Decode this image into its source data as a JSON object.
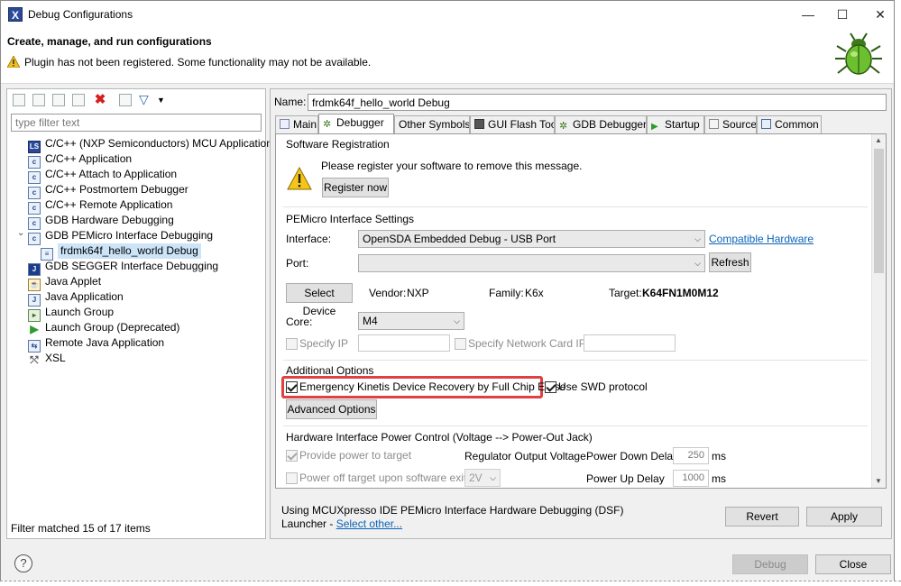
{
  "window": {
    "title": "Debug Configurations",
    "minimize": "—",
    "maximize": "☐",
    "close": "✕"
  },
  "header": {
    "title": "Create, manage, and run configurations",
    "message": "Plugin has not been registered. Some functionality may not be available."
  },
  "left": {
    "filter_placeholder": "type filter text",
    "items": [
      {
        "label": "C/C++ (NXP Semiconductors) MCU Application",
        "icon": "ls-icon"
      },
      {
        "label": "C/C++ Application",
        "icon": "c-icon"
      },
      {
        "label": "C/C++ Attach to Application",
        "icon": "c-icon"
      },
      {
        "label": "C/C++ Postmortem Debugger",
        "icon": "c-icon"
      },
      {
        "label": "C/C++ Remote Application",
        "icon": "c-icon"
      },
      {
        "label": "GDB Hardware Debugging",
        "icon": "c-icon"
      },
      {
        "label": "GDB PEMicro Interface Debugging",
        "icon": "c-icon"
      },
      {
        "label": "frdmk64f_hello_world Debug",
        "icon": "config-icon"
      },
      {
        "label": "GDB SEGGER Interface Debugging",
        "icon": "jlink-icon"
      },
      {
        "label": "Java Applet",
        "icon": "applet-icon"
      },
      {
        "label": "Java Application",
        "icon": "java-icon"
      },
      {
        "label": "Launch Group",
        "icon": "launch-group-icon"
      },
      {
        "label": "Launch Group (Deprecated)",
        "icon": "play-icon"
      },
      {
        "label": "Remote Java Application",
        "icon": "remote-java-icon"
      },
      {
        "label": "XSL",
        "icon": "xsl-icon"
      }
    ],
    "status": "Filter matched 15 of 17 items"
  },
  "right": {
    "name_label": "Name:",
    "name_value": "frdmk64f_hello_world Debug",
    "tabs": [
      "Main",
      "Debugger",
      "Other Symbols",
      "GUI Flash Tool",
      "GDB Debugger",
      "Startup",
      "Source",
      "Common"
    ],
    "software_registration": {
      "title": "Software Registration",
      "message": "Please register your software to remove this message.",
      "register_button": "Register now"
    },
    "pemicro": {
      "title": "PEMicro Interface Settings",
      "interface_label": "Interface:",
      "interface_value": "OpenSDA Embedded Debug - USB Port",
      "compatible_link": "Compatible Hardware",
      "port_label": "Port:",
      "port_value": "",
      "refresh_button": "Refresh",
      "select_device_button": "Select Device",
      "vendor_label": "Vendor:",
      "vendor_value": "NXP",
      "family_label": "Family:",
      "family_value": "K6x",
      "target_label": "Target:",
      "target_value": "K64FN1M0M12",
      "core_label": "Core:",
      "core_value": "M4",
      "specify_ip": "Specify IP",
      "specify_network_card_ip": "Specify Network Card IP"
    },
    "additional": {
      "title": "Additional Options",
      "emergency_label": "Emergency Kinetis Device Recovery by Full Chip Erase",
      "swd_label": "Use SWD protocol",
      "advanced_button": "Advanced Options"
    },
    "power": {
      "title": "Hardware Interface Power Control (Voltage --> Power-Out Jack)",
      "provide_power": "Provide power to target",
      "regulator_label": "Regulator Output Voltage",
      "power_down_label": "Power Down Delay",
      "power_down_value": "250",
      "power_down_unit": "ms",
      "power_off_label": "Power off target upon software exit",
      "voltage_value": "2V",
      "power_up_label": "Power Up Delay",
      "power_up_value": "1000",
      "power_up_unit": "ms"
    },
    "launcher": {
      "line1": "Using MCUXpresso IDE PEMicro Interface Hardware Debugging (DSF)",
      "line2_prefix": "Launcher - ",
      "select_other": "Select other..."
    },
    "revert_button": "Revert",
    "apply_button": "Apply"
  },
  "footer": {
    "help": "?",
    "debug_button": "Debug",
    "close_button": "Close"
  },
  "colors": {
    "highlight": "#e04040",
    "link": "#0a63b8",
    "selection": "#cce4f7"
  }
}
